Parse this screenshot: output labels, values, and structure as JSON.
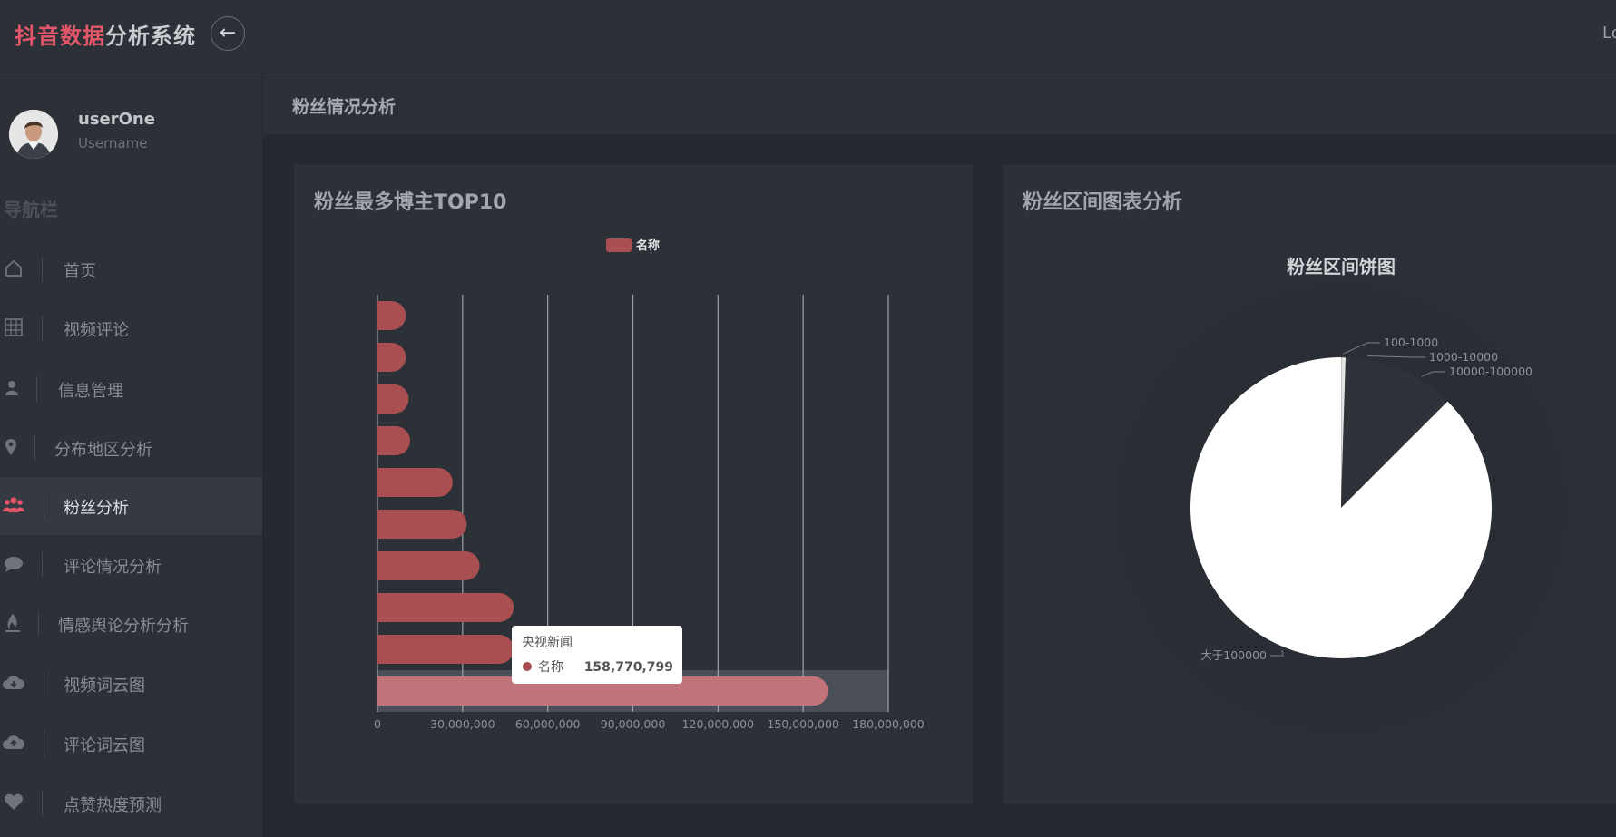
{
  "header": {
    "logo_accent": "抖音数据",
    "logo_rest": "分析系统",
    "right_text": "Lo"
  },
  "user": {
    "name": "userOne",
    "subtitle": "Username"
  },
  "sidebar": {
    "title": "导航栏",
    "items": [
      {
        "label": "首页",
        "icon": "home-icon"
      },
      {
        "label": "视频评论",
        "icon": "grid-icon"
      },
      {
        "label": "信息管理",
        "icon": "user-icon"
      },
      {
        "label": "分布地区分析",
        "icon": "map-pin-icon"
      },
      {
        "label": "粉丝分析",
        "icon": "users-icon"
      },
      {
        "label": "评论情况分析",
        "icon": "comment-icon"
      },
      {
        "label": "情感舆论分析分析",
        "icon": "fire-icon"
      },
      {
        "label": "视频词云图",
        "icon": "cloud-download-icon"
      },
      {
        "label": "评论词云图",
        "icon": "cloud-upload-icon"
      },
      {
        "label": "点赞热度预测",
        "icon": "heart-icon"
      }
    ],
    "active_index": 4
  },
  "page": {
    "title": "粉丝情况分析"
  },
  "colors": {
    "accent": "#e4566a",
    "bar": "#a94e51",
    "bar_highlight": "#c3737a",
    "pie_fill": "#ffffff"
  },
  "cards": {
    "bar_title": "粉丝最多博主TOP10",
    "pie_title": "粉丝区间图表分析"
  },
  "chart_data": [
    {
      "type": "bar",
      "orientation": "horizontal",
      "title": "",
      "legend": [
        "名称"
      ],
      "legend_position": "top",
      "xlim": [
        0,
        180000000
      ],
      "x_ticks": [
        "0",
        "30,000,000",
        "60,000,000",
        "90,000,000",
        "120,000,000",
        "150,000,000",
        "180,000,000"
      ],
      "grid": true,
      "series": [
        {
          "name": "名称",
          "values": [
            10000000,
            10000000,
            11000000,
            11500000,
            26500000,
            31500000,
            36000000,
            48000000,
            48000000,
            158770799
          ]
        }
      ],
      "tooltip": {
        "category": "央视新闻",
        "series": "名称",
        "value": "158,770,799"
      }
    },
    {
      "type": "pie",
      "title": "粉丝区间饼图",
      "slices": [
        {
          "label": "100-1000",
          "value": 0.5
        },
        {
          "label": "1000-10000",
          "value": 4.5
        },
        {
          "label": "10000-100000",
          "value": 7.5
        },
        {
          "label": "大于100000",
          "value": 87.5
        }
      ]
    }
  ]
}
